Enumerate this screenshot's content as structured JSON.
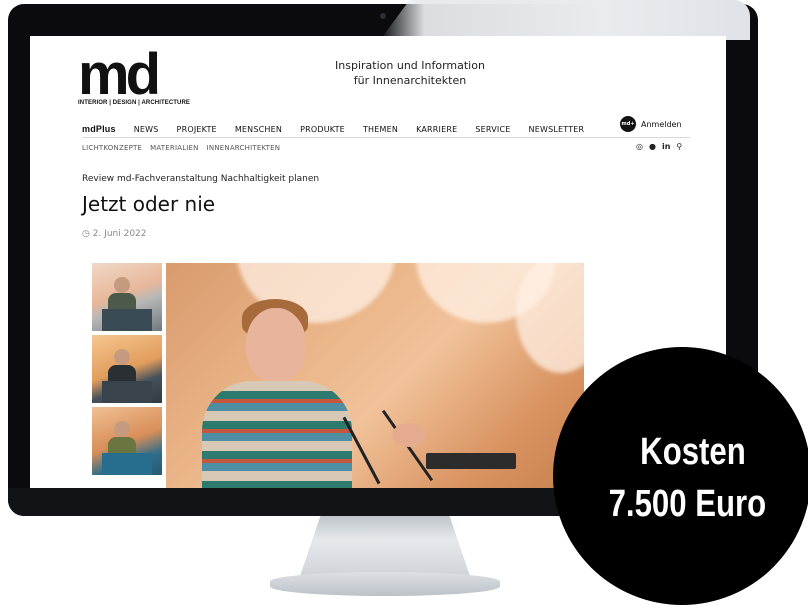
{
  "site": {
    "logo_mark": "md",
    "logo_tagline": "INTERIOR | DESIGN | ARCHITECTURE",
    "tagline_line1": "Inspiration und Information",
    "tagline_line2": "für Innenarchitekten"
  },
  "nav": {
    "items": [
      "mdPlus",
      "NEWS",
      "PROJEKTE",
      "MENSCHEN",
      "PRODUKTE",
      "THEMEN",
      "KARRIERE",
      "SERVICE",
      "NEWSLETTER"
    ],
    "login_icon_text": "md+",
    "login_label": "Anmelden"
  },
  "subnav": {
    "items": [
      "LICHTKONZEPTE",
      "MATERIALIEN",
      "INNENARCHITEKTEN"
    ]
  },
  "social_icons": [
    "instagram-icon",
    "facebook-icon",
    "linkedin-icon",
    "search-icon"
  ],
  "article": {
    "kicker": "Review md-Fachveranstaltung Nachhaltigkeit planen",
    "title": "Jetzt oder nie",
    "date": "2. Juni 2022"
  },
  "badge": {
    "line1": "Kosten",
    "line2": "7.500 Euro"
  }
}
